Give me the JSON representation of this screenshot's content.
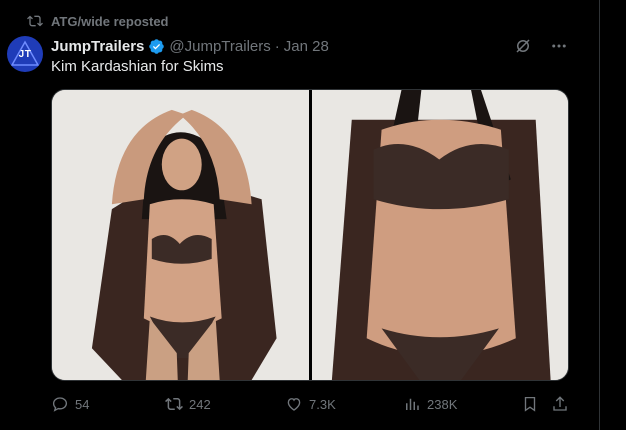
{
  "repost": {
    "label": "ATG/wide reposted",
    "icon": "repost-icon"
  },
  "author": {
    "avatar_text": "JT",
    "name": "JumpTrailers",
    "handle": "@JumpTrailers",
    "separator": "·",
    "date": "Jan 28"
  },
  "post": {
    "text": "Kim Kardashian for Skims"
  },
  "stats": {
    "replies": "54",
    "reposts": "242",
    "likes": "7.3K",
    "views": "238K"
  },
  "colors": {
    "background": "#000000",
    "muted": "#71767b",
    "text": "#e7e9ea",
    "verified": "#1d9bf0",
    "avatar": "#1f3cb8"
  }
}
